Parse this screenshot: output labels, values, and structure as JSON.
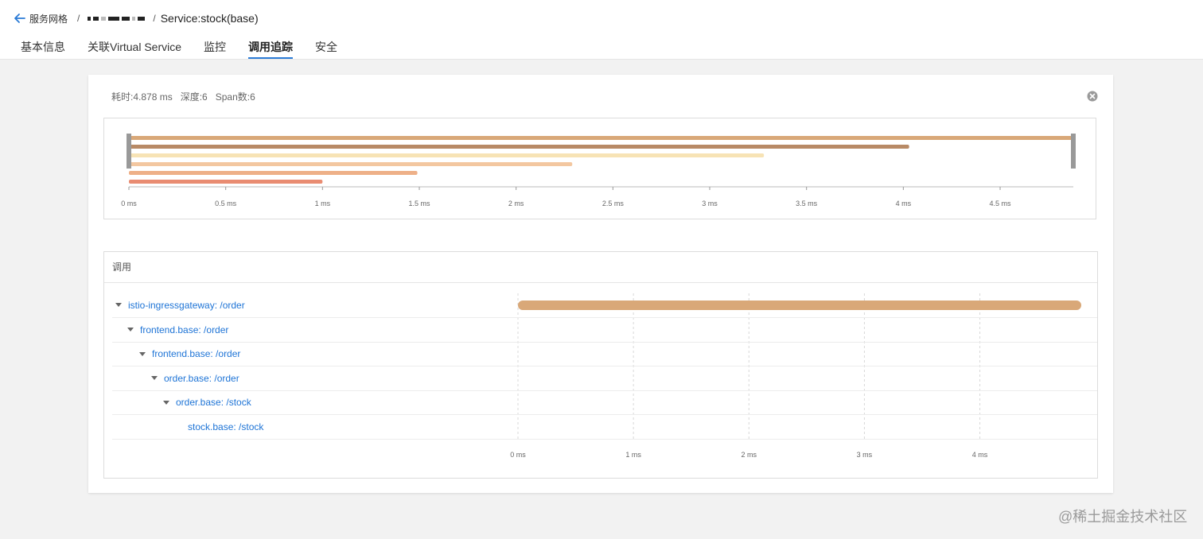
{
  "breadcrumb": {
    "root": "服务网格",
    "separator": "/",
    "current": "Service:stock(base)"
  },
  "tabs": [
    {
      "label": "基本信息",
      "active": false
    },
    {
      "label": "关联Virtual Service",
      "active": false
    },
    {
      "label": "监控",
      "active": false
    },
    {
      "label": "调用追踪",
      "active": true
    },
    {
      "label": "安全",
      "active": false
    }
  ],
  "summary": {
    "duration": "耗时:4.878 ms",
    "depth": "深度:6",
    "span_count": "Span数:6"
  },
  "colors": {
    "accent": "#2b7bd6",
    "link": "#1e74d6",
    "span_bar": "#d9a878"
  },
  "calls_section": {
    "title": "调用"
  },
  "chart_data": {
    "type": "bar",
    "unit": "ms",
    "total_duration": 4.878,
    "spans": [
      {
        "name": "istio-ingressgateway: /order",
        "start": 0,
        "duration": 4.878,
        "depth": 0,
        "color": "#d9a878",
        "expandable": true
      },
      {
        "name": "frontend.base: /order",
        "start": 0,
        "duration": 4.03,
        "depth": 1,
        "color": "#b88a66",
        "expandable": true
      },
      {
        "name": "frontend.base: /order",
        "start": 0,
        "duration": 3.28,
        "depth": 2,
        "color": "#f7e3b5",
        "expandable": true
      },
      {
        "name": "order.base: /order",
        "start": 0,
        "duration": 2.29,
        "depth": 3,
        "color": "#f3c7a0",
        "expandable": true
      },
      {
        "name": "order.base: /stock",
        "start": 0,
        "duration": 1.49,
        "depth": 4,
        "color": "#eeb088",
        "expandable": true
      },
      {
        "name": "stock.base: /stock",
        "start": 0,
        "duration": 1.0,
        "depth": 5,
        "color": "#e98c72",
        "expandable": false
      }
    ],
    "overview_axis": {
      "min": 0,
      "max": 4.878,
      "ticks": [
        0,
        0.5,
        1,
        1.5,
        2,
        2.5,
        3,
        3.5,
        4,
        4.5
      ],
      "tick_labels": [
        "0 ms",
        "0.5 ms",
        "1 ms",
        "1.5 ms",
        "2 ms",
        "2.5 ms",
        "3 ms",
        "3.5 ms",
        "4 ms",
        "4.5 ms"
      ]
    },
    "timeline_axis": {
      "min": 0,
      "max": 4.878,
      "ticks": [
        0,
        1,
        2,
        3,
        4
      ],
      "tick_labels": [
        "0 ms",
        "1 ms",
        "2 ms",
        "3 ms",
        "4 ms"
      ]
    },
    "timeline_bar": {
      "span": "istio-ingressgateway: /order",
      "start": 0,
      "duration": 4.878
    }
  },
  "watermark": "@稀土掘金技术社区"
}
